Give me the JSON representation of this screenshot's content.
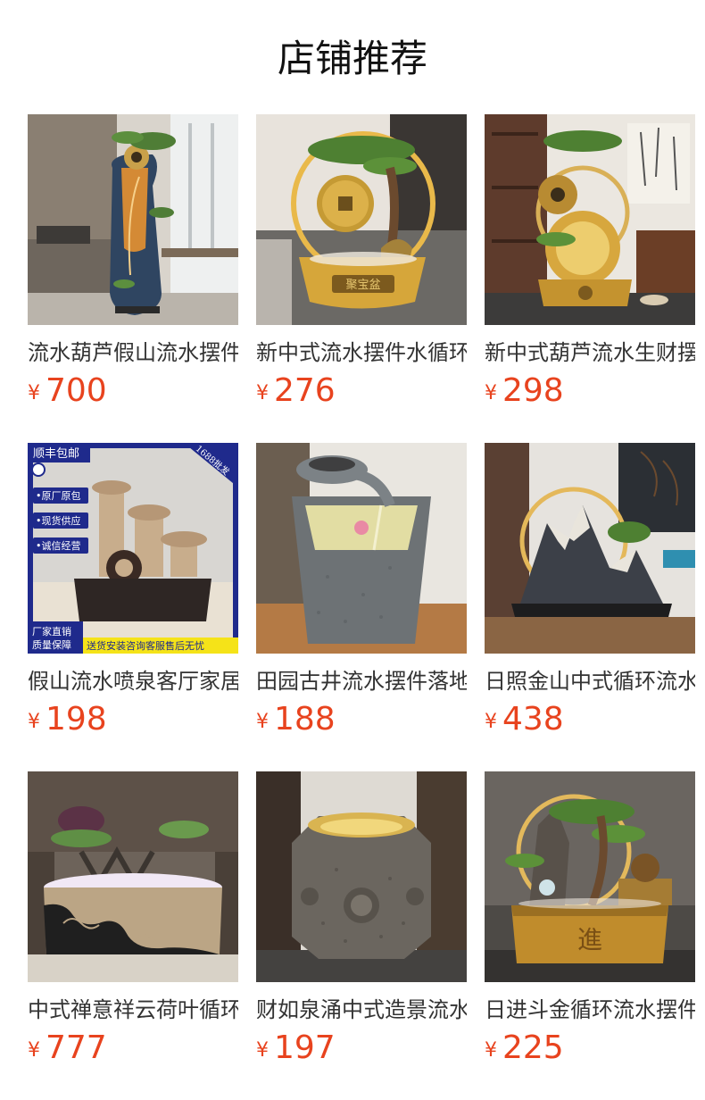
{
  "section": {
    "title": "店铺推荐"
  },
  "currency": "¥",
  "products": [
    {
      "name": "流水葫芦假山流水摆件",
      "price": "700",
      "image": "gourd-pine-fountain-floor"
    },
    {
      "name": "新中式流水摆件水循环",
      "price": "276",
      "image": "coin-pine-fountain"
    },
    {
      "name": "新中式葫芦流水生财摆件",
      "price": "298",
      "image": "gourd-coin-fountain"
    },
    {
      "name": "假山流水喷泉客厅家居",
      "price": "198",
      "image": "tiered-bowl-fountain",
      "badges": {
        "top_left": "顺丰包邮",
        "top_right": "1688批发",
        "side": [
          "•原厂原包",
          "•现货供应",
          "•诚信经营"
        ],
        "bottom_left_1": "厂家直销",
        "bottom_left_2": "质量保障",
        "bottom_right": "送货安装咨询客服售后无忧"
      }
    },
    {
      "name": "田园古井流水摆件落地",
      "price": "188",
      "image": "stone-well-fountain"
    },
    {
      "name": "日照金山中式循环流水",
      "price": "438",
      "image": "golden-mountain-fountain"
    },
    {
      "name": "中式禅意祥云荷叶循环",
      "price": "777",
      "image": "lotus-cloud-fountain"
    },
    {
      "name": "财如泉涌中式造景流水",
      "price": "197",
      "image": "hexagon-stone-fountain"
    },
    {
      "name": "日进斗金循环流水摆件",
      "price": "225",
      "image": "pine-lion-fountain"
    }
  ]
}
